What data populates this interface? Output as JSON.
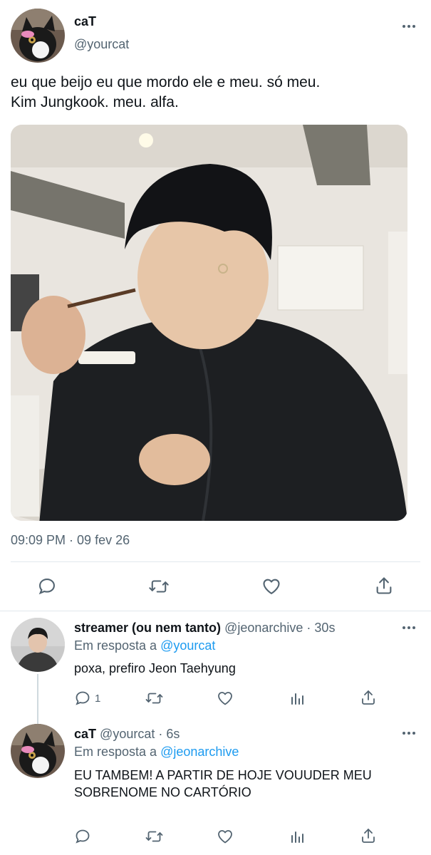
{
  "main_tweet": {
    "author_name": "caT",
    "author_handle": "@yourcat",
    "text_line1": "eu que beijo eu que mordo ele e meu. só meu.",
    "text_line2": "Kim Jungkook. meu. alfa.",
    "timestamp": "09:09 PM · 09 fev 26",
    "actions": [
      "reply-icon",
      "retweet-icon",
      "like-icon",
      "share-icon"
    ]
  },
  "reply1": {
    "author_name": "streamer (ou nem tanto)",
    "author_handle": "@jeonarchive",
    "time": "· 30s",
    "reply_prefix": "Em resposta a",
    "reply_to": "@yourcat",
    "text": "poxa, prefiro Jeon Taehyung",
    "reply_count": "1",
    "actions": [
      "reply-icon",
      "retweet-icon",
      "like-icon",
      "analytics-icon",
      "share-icon"
    ]
  },
  "reply2": {
    "author_name": "caT",
    "author_handle": "@yourcat",
    "time": "· 6s",
    "reply_prefix": "Em resposta a",
    "reply_to": "@jeonarchive",
    "text_line1": "EU TAMBEM! A PARTIR DE HOJE VOUUDER MEU",
    "text_line2": "SOBRENOME NO CARTÓRIO",
    "actions": [
      "reply-icon",
      "retweet-icon",
      "like-icon",
      "analytics-icon",
      "share-icon"
    ]
  },
  "colors": {
    "text": "#0f1419",
    "secondary": "#536471",
    "link": "#1d9bf0",
    "divider": "#e1e8ed",
    "thread_line": "#cfd9de"
  }
}
